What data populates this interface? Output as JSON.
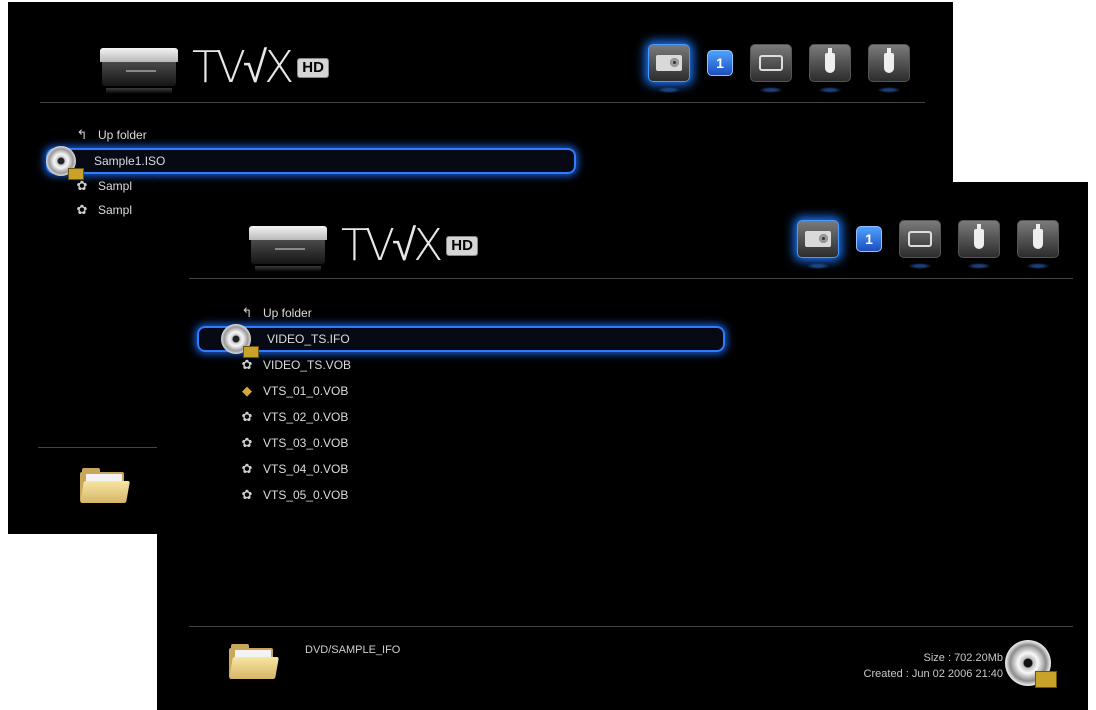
{
  "brand": {
    "logo_text": "TV√X",
    "hd_text": "HD"
  },
  "status_icons": [
    {
      "icon": "dvd-drive-icon",
      "active": true
    },
    {
      "icon": "number-badge",
      "label": "1"
    },
    {
      "icon": "tv-output-icon"
    },
    {
      "icon": "usb-plug-icon"
    },
    {
      "icon": "usb-plug-icon"
    }
  ],
  "back_screen": {
    "items": [
      {
        "label": "Up folder",
        "icon": "up-folder-icon"
      },
      {
        "label": "Sample1.ISO",
        "icon": "disc-video-icon",
        "selected": true
      },
      {
        "label": "Sampl",
        "icon": "gear-file-icon"
      },
      {
        "label": "Sampl",
        "icon": "gear-file-icon"
      }
    ]
  },
  "front_screen": {
    "items": [
      {
        "label": "Up folder",
        "icon": "up-folder-icon"
      },
      {
        "label": "VIDEO_TS.IFO",
        "icon": "disc-video-icon",
        "selected": true
      },
      {
        "label": "VIDEO_TS.VOB",
        "icon": "gear-file-icon"
      },
      {
        "label": "VTS_01_0.VOB",
        "icon": "play-file-icon"
      },
      {
        "label": "VTS_02_0.VOB",
        "icon": "gear-file-icon"
      },
      {
        "label": "VTS_03_0.VOB",
        "icon": "gear-file-icon"
      },
      {
        "label": "VTS_04_0.VOB",
        "icon": "gear-file-icon"
      },
      {
        "label": "VTS_05_0.VOB",
        "icon": "gear-file-icon"
      }
    ],
    "footer": {
      "path": "DVD/SAMPLE_IFO",
      "size": "Size : 702.20Mb",
      "created": "Created : Jun 02 2006   21:40"
    }
  }
}
